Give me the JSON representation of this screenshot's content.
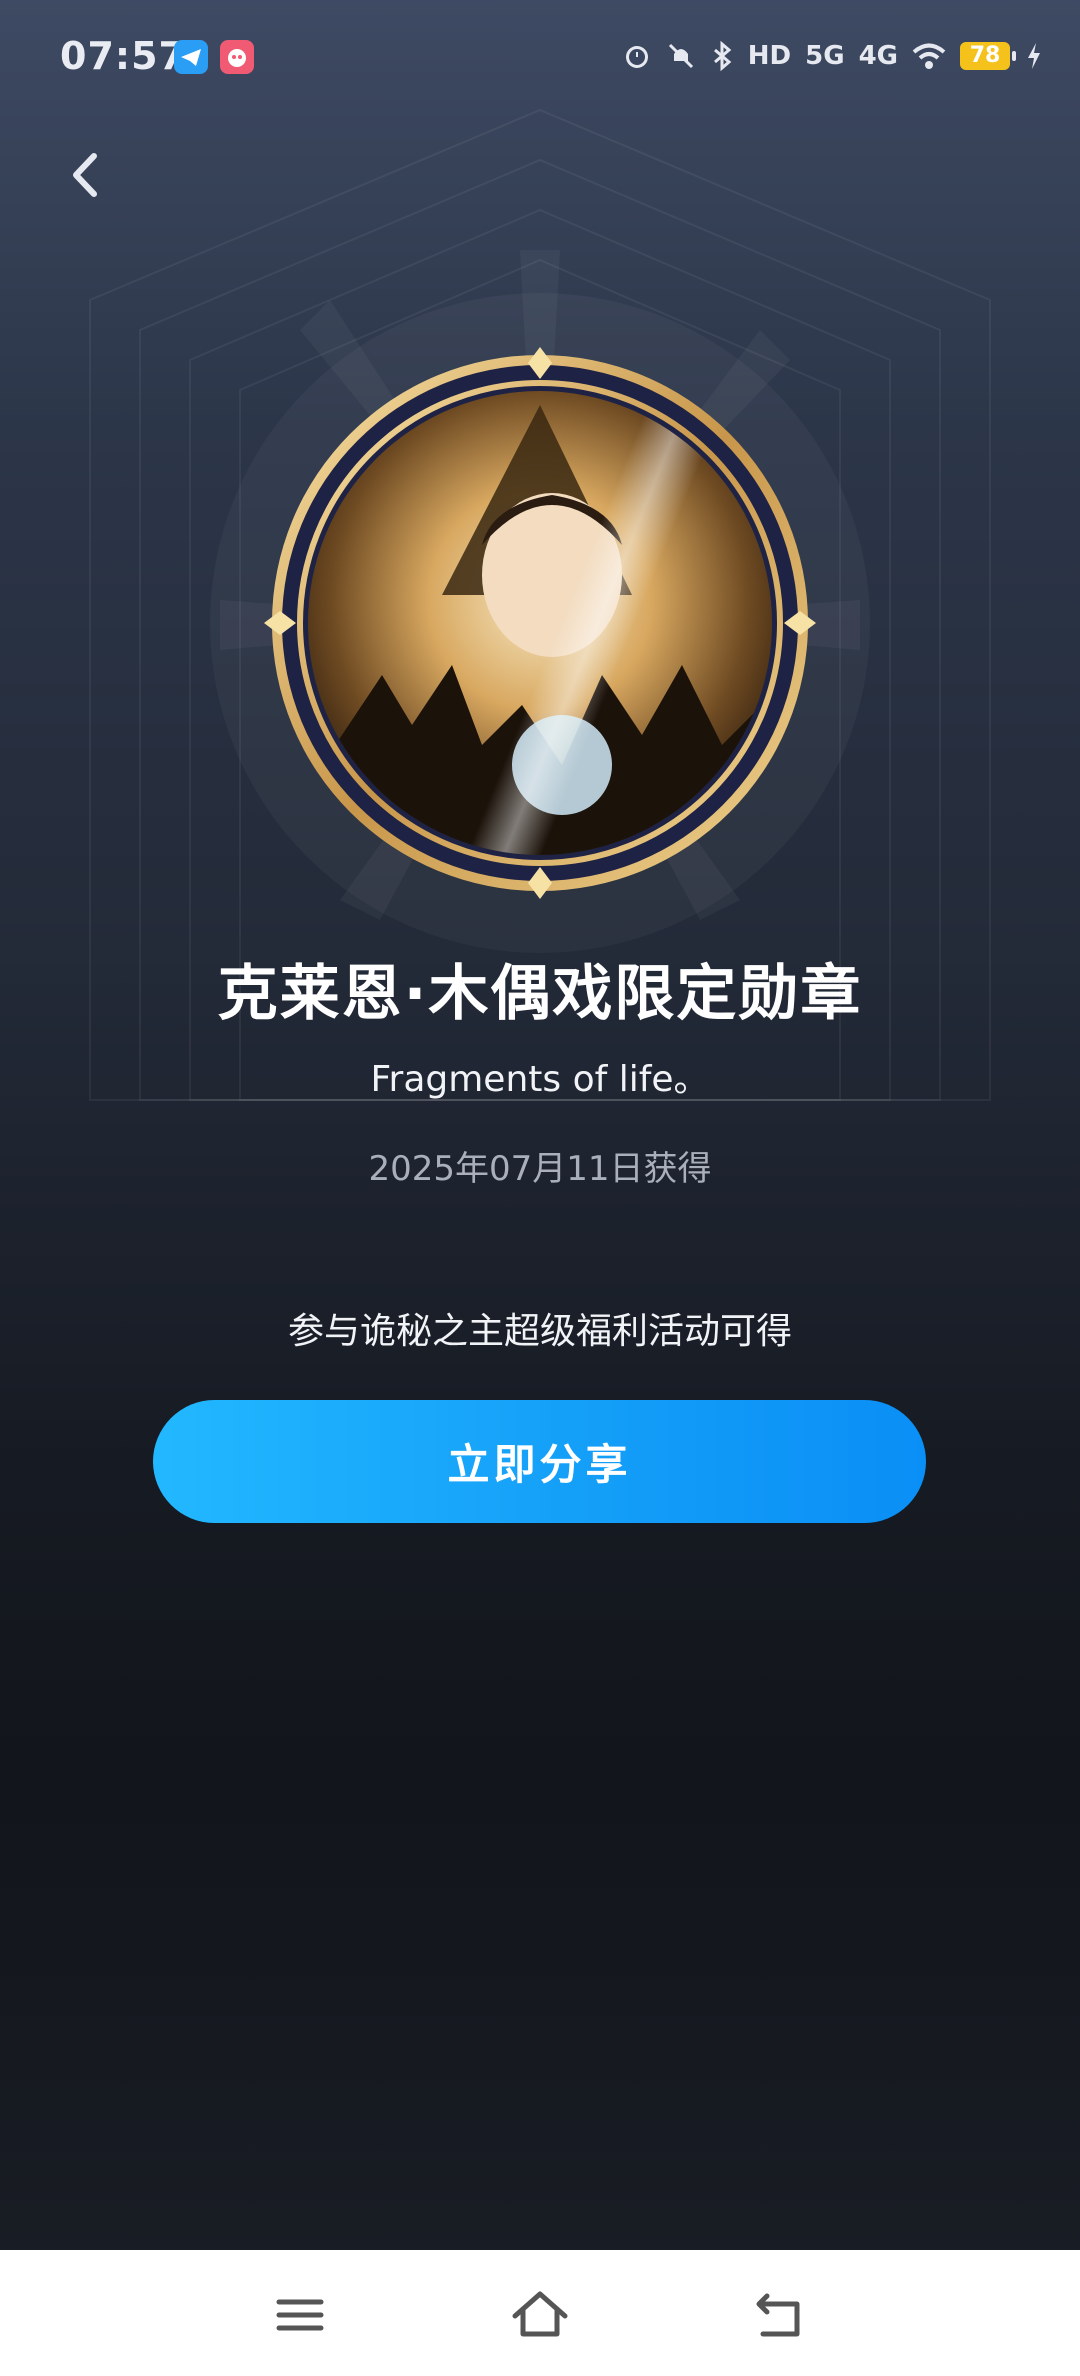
{
  "status_bar": {
    "time": "07:57",
    "icons": [
      "telegram-icon",
      "app-icon",
      "alarm-icon",
      "mute-icon",
      "bluetooth-icon",
      "hd-icon",
      "5g-signal-icon",
      "4g-signal-icon",
      "wifi-icon",
      "battery-icon",
      "charging-icon"
    ],
    "hd": "HD",
    "net_5g": "5G",
    "net_4g": "4G",
    "battery": "78"
  },
  "medal": {
    "title": "克莱恩·木偶戏限定勋章",
    "subtitle": "Fragments of life。",
    "obtained_date": "2025年07月11日获得",
    "condition": "参与诡秘之主超级福利活动可得"
  },
  "actions": {
    "share_label": "立即分享"
  },
  "colors": {
    "accent": "#149ff8",
    "medal_gold": "#e2b458"
  },
  "nav": {
    "icons": [
      "menu-icon",
      "home-icon",
      "back-icon"
    ]
  }
}
